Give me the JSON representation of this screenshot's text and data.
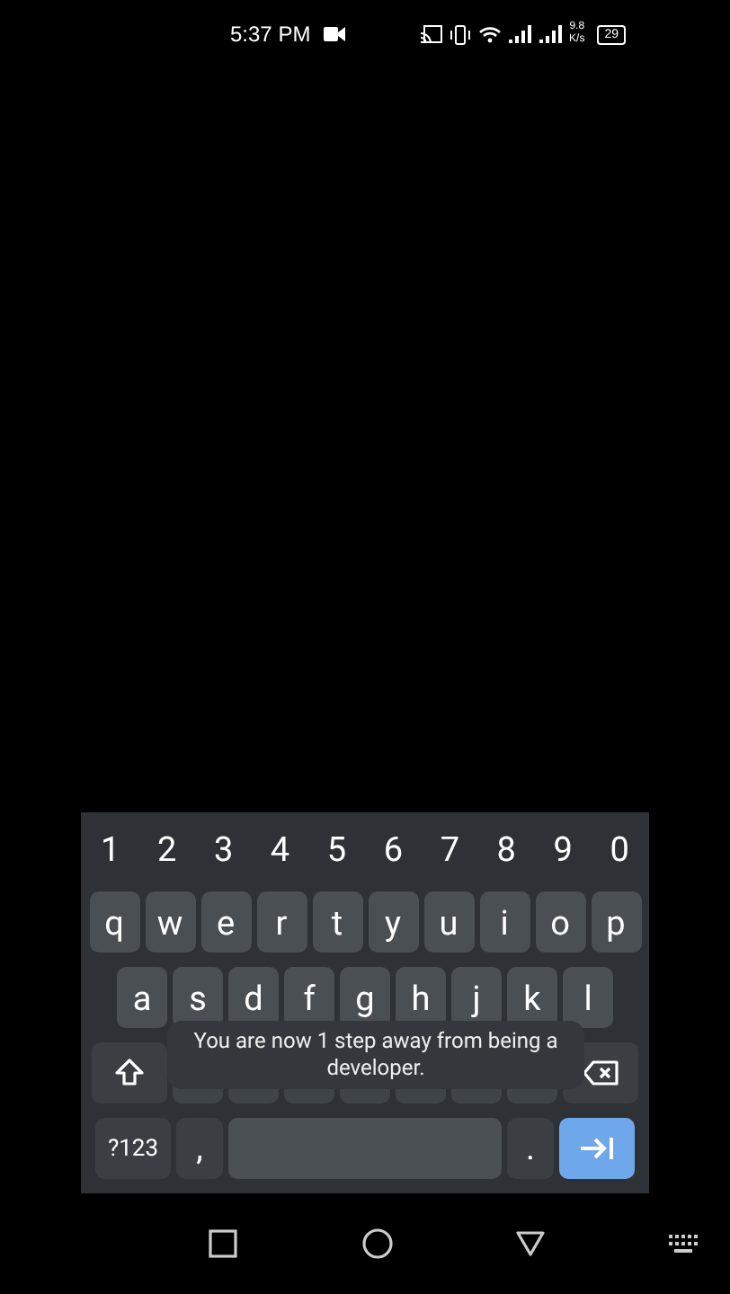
{
  "status_bar": {
    "time": "5:37 PM",
    "speed": "9.8",
    "speed_unit": "K/s",
    "battery": "29"
  },
  "keyboard": {
    "number_row": [
      "1",
      "2",
      "3",
      "4",
      "5",
      "6",
      "7",
      "8",
      "9",
      "0"
    ],
    "letter_rows": [
      [
        "q",
        "w",
        "e",
        "r",
        "t",
        "y",
        "u",
        "i",
        "o",
        "p"
      ],
      [
        "a",
        "s",
        "d",
        "f",
        "g",
        "h",
        "j",
        "k",
        "l"
      ]
    ],
    "symbols_key": "?123",
    "comma_key": ",",
    "period_key": "."
  },
  "toast": {
    "text": "You are now 1 step away from being a developer."
  }
}
